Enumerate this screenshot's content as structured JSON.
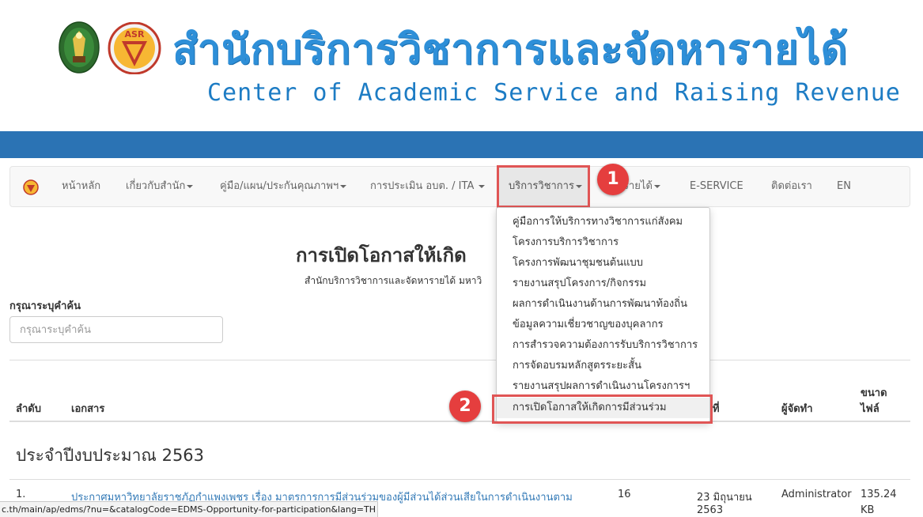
{
  "header": {
    "title_th": "สำนักบริการวิชาการและจัดหารายได้",
    "title_en": "Center of Academic Service and Raising Revenue",
    "logo2_text": "ASR"
  },
  "colors": {
    "brand_blue": "#2e8fd8",
    "band_blue": "#2b73b4",
    "callout_red": "#e53e3e",
    "link_blue": "#337ab7"
  },
  "navbar": {
    "items": [
      {
        "label": "หน้าหลัก",
        "dropdown": false
      },
      {
        "label": "เกี่ยวกับสำนัก",
        "dropdown": true
      },
      {
        "label": "คู่มือ/แผน/ประกันคุณภาพฯ",
        "dropdown": true
      },
      {
        "label": "การประเมิน อบต. / ITA",
        "dropdown": true
      },
      {
        "label": "บริการวิชาการ",
        "dropdown": true,
        "active": true
      },
      {
        "label": "รายได้",
        "dropdown": true
      },
      {
        "label": "E-SERVICE",
        "dropdown": false
      },
      {
        "label": "ติดต่อเรา",
        "dropdown": false
      },
      {
        "label": "EN",
        "dropdown": false
      }
    ]
  },
  "callouts": [
    "1",
    "2"
  ],
  "dropdown": {
    "items": [
      "คู่มือการให้บริการทางวิชาการแก่สังคม",
      "โครงการบริการวิชาการ",
      "โครงการพัฒนาชุมชนต้นแบบ",
      "รายงานสรุปโครงการ/กิจกรรม",
      "ผลการดำเนินงานด้านการพัฒนาท้องถิ่น",
      "ข้อมูลความเชี่ยวชาญของบุคลากร",
      "การสำรวจความต้องการรับบริการวิชาการ",
      "การจัดอบรมหลักสูตรระยะสั้น",
      "รายงานสรุปผลการดำเนินงานโครงการฯ",
      "การเปิดโอกาสให้เกิดการมีส่วนร่วม"
    ]
  },
  "main": {
    "title": "การเปิดโอกาสให้เกิด",
    "subtitle": "สำนักบริการวิชาการและจัดหารายได้ มหาวิ",
    "search_label": "กรุณาระบุคำค้น",
    "search_placeholder": "กรุณาระบุคำค้น",
    "table": {
      "headers": {
        "index": "ลำดับ",
        "document": "เอกสาร",
        "date": "ที่",
        "author": "ผู้จัดทำ",
        "size_line1": "ขนาด",
        "size_line2": "ไฟล์"
      },
      "section": "ประจำปีงบประมาณ 2563",
      "rows": [
        {
          "index": "1.",
          "document": "ประกาศมหาวิทยาลัยราชภัฏกำแพงเพชร เรื่อง มาตรการการมีส่วนร่วมของผู้มีส่วนได้ส่วนเสียในการดำเนินงานตาม",
          "views": "16",
          "date_line1": "23 มิถุนายน",
          "date_line2": "2563",
          "author": "Administrator",
          "size_line1": "135.24",
          "size_line2": "KB"
        }
      ]
    }
  },
  "statusbar": {
    "url": "c.th/main/ap/edms/?nu=&catalogCode=EDMS-Opportunity-for-participation&lang=TH"
  }
}
